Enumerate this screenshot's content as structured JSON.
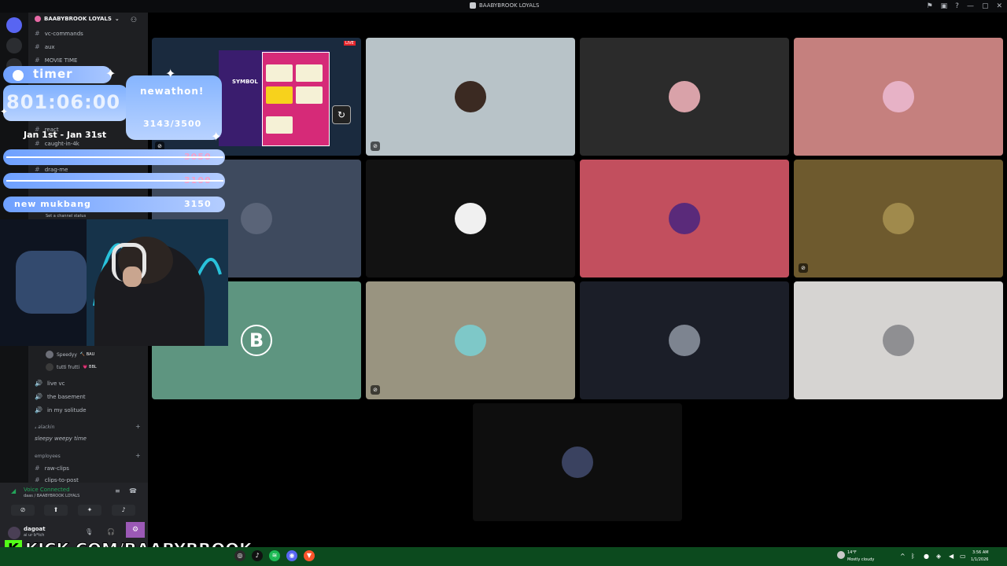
{
  "window": {
    "title": "BAABYBROOK LOYALS",
    "controls": [
      "—",
      "▢",
      "✕"
    ]
  },
  "server": {
    "name": "BAABYBROOK LOYALS"
  },
  "channels": {
    "top": [
      {
        "icon": "#",
        "name": "vc-commands"
      },
      {
        "icon": "#",
        "name": "aux"
      },
      {
        "icon": "#",
        "name": "MOVIE TIME"
      }
    ],
    "mid": [
      {
        "icon": "#",
        "name": "react"
      },
      {
        "icon": "#",
        "name": "caught-in-4k"
      },
      {
        "icon": "#",
        "name": "drag-me"
      }
    ],
    "status_hint": "Set a channel status",
    "voice_users": [
      {
        "name": "Speedyy",
        "tag": "🔨 BAU"
      },
      {
        "name": "tutti frutti",
        "tag": "💗 BBL"
      }
    ],
    "voice_channels": [
      {
        "name": "live vc"
      },
      {
        "name": "the basement"
      },
      {
        "name": "in my solitude"
      }
    ],
    "category_1": "𝓈 alackin",
    "category_1_channel": "sleepy weepy time",
    "category_2": "employees",
    "category_2_channels": [
      {
        "icon": "#",
        "name": "raw-clips"
      },
      {
        "icon": "#",
        "name": "clips-to-post"
      }
    ]
  },
  "voice_panel": {
    "title": "Voice Connected",
    "subtitle": "daas / BAABYBROOK LOYALS"
  },
  "user_panel": {
    "name": "dagoat",
    "status": "ai ur b*tch"
  },
  "overlay": {
    "timer_label": "timer",
    "timer_value": "801:06:00",
    "subathon_title": "newathon!",
    "subathon_count": "3143/3500",
    "dates": "Jan 1st - Jan 31st",
    "goals": [
      {
        "label": "",
        "value": "3050",
        "done": true
      },
      {
        "label": "",
        "value": "3100",
        "done": true
      },
      {
        "label": "new mukbang",
        "value": "3150",
        "done": false
      }
    ],
    "stream_url": "KICK.COM/BAABYBROOK"
  },
  "stream_preview": {
    "game_text": "SYMBOL",
    "live_badge": "LIVE"
  },
  "tiles": [
    {
      "color": "#b8c3c8",
      "avatar": "#3b2a22",
      "badge": "⊘"
    },
    {
      "color": "#2b2b2b",
      "avatar": "#d9a2a9",
      "badge": ""
    },
    {
      "color": "#c5807e",
      "avatar": "#e7b2c6",
      "badge": ""
    },
    {
      "color": "#3e4a5e",
      "avatar": "#5a6478",
      "badge": ""
    },
    {
      "color": "#121212",
      "avatar": "#f0f0f0",
      "badge": ""
    },
    {
      "color": "#c24f5e",
      "avatar": "#5a2a7a",
      "badge": ""
    },
    {
      "color": "#6e5a2e",
      "avatar": "#a08a4c",
      "badge": "⊘"
    },
    {
      "color": "#5e9580",
      "avatar": "#ffffff",
      "letter": "B",
      "badge": ""
    },
    {
      "color": "#999480",
      "avatar": "#7ec8c8",
      "badge": "⊘"
    },
    {
      "color": "#1b1e28",
      "avatar": "#7d8490",
      "badge": ""
    },
    {
      "color": "#d6d4d2",
      "avatar": "#8f8f92",
      "badge": ""
    },
    {
      "color": "#0e0e0e",
      "avatar": "#3a4260",
      "badge": ""
    }
  ],
  "weather": {
    "temp": "14°F",
    "desc": "Mostly cloudy"
  },
  "clock": {
    "time": "3:56 AM",
    "date": "1/1/2026"
  }
}
